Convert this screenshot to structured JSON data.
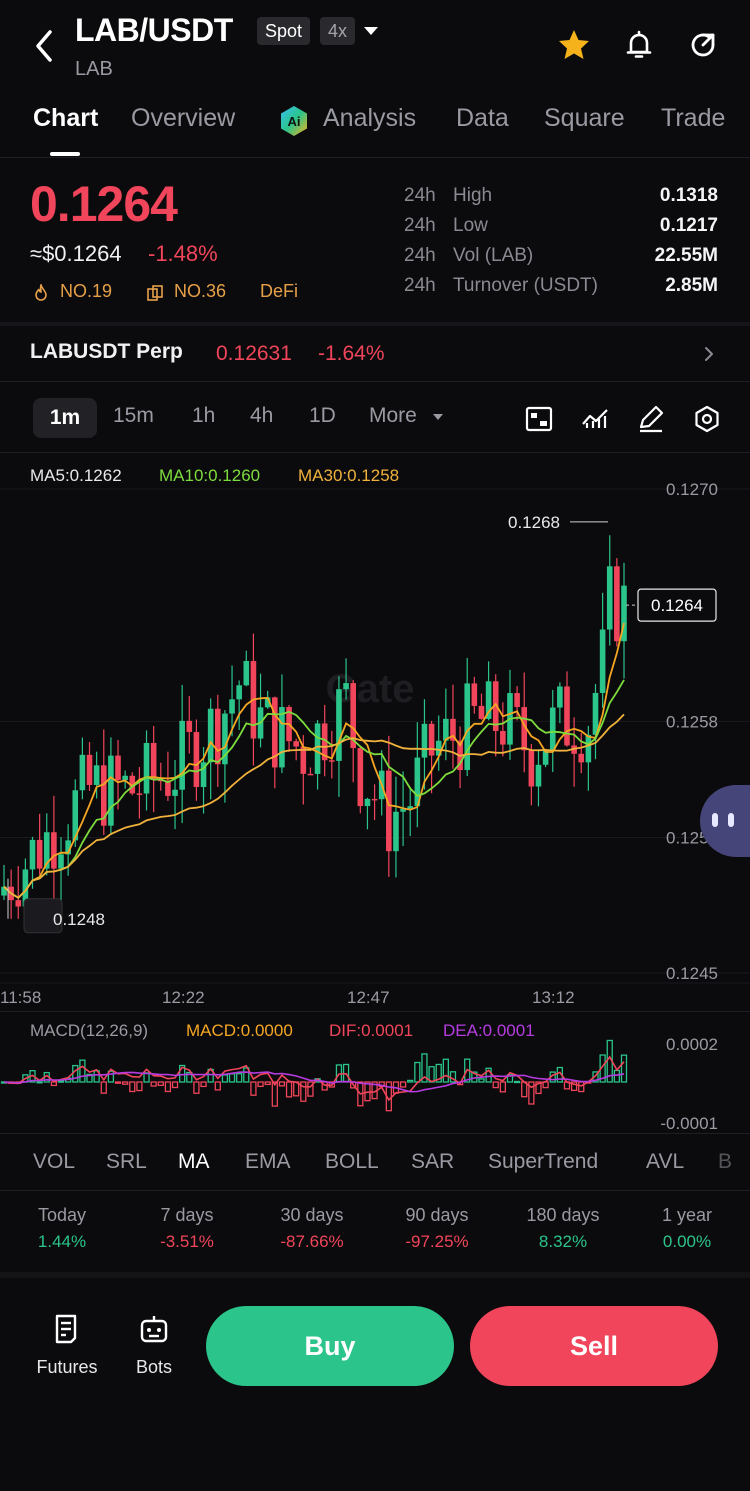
{
  "header": {
    "pair": "LAB/USDT",
    "spot_tag": "Spot",
    "leverage_tag": "4x",
    "subtitle": "LAB"
  },
  "tabs": [
    "Chart",
    "Overview",
    "Analysis",
    "Data",
    "Square",
    "Trade"
  ],
  "price": {
    "last": "0.1264",
    "usd": "≈$0.1264",
    "change": "-1.48%",
    "rank1": "NO.19",
    "rank2": "NO.36",
    "sector": "DeFi"
  },
  "stats": [
    {
      "k1": "24h",
      "k2": "High",
      "v": "0.1318"
    },
    {
      "k1": "24h",
      "k2": "Low",
      "v": "0.1217"
    },
    {
      "k1": "24h",
      "k2": "Vol (LAB)",
      "v": "22.55M"
    },
    {
      "k1": "24h",
      "k2": "Turnover (USDT)",
      "v": "2.85M"
    }
  ],
  "perp": {
    "name": "LABUSDT Perp",
    "price": "0.12631",
    "change": "-1.64%"
  },
  "intervals": [
    "1m",
    "15m",
    "1h",
    "4h",
    "1D",
    "More"
  ],
  "ma_legend": {
    "ma5": "MA5:0.1262",
    "ma10": "MA10:0.1260",
    "ma30": "MA30:0.1258"
  },
  "colors": {
    "ma5": "#f5a623",
    "ma10": "#7ddc3d",
    "ma30": "#f0b23c",
    "up": "#2bc48a",
    "down": "#f0455a",
    "macd": "#f5a623",
    "dif": "#f0455a",
    "dea": "#b63ce0"
  },
  "chart_data": {
    "type": "candlestick",
    "y_ticks": [
      "0.1270",
      "0.1258",
      "0.1252",
      "0.1245"
    ],
    "x_ticks": [
      "11:58",
      "12:22",
      "12:47",
      "13:12"
    ],
    "ylim": [
      0.1245,
      0.127
    ],
    "high_label": "0.1268",
    "low_label": "0.1248",
    "last_label": "0.1264",
    "watermark": "Gate"
  },
  "macd": {
    "label": "MACD(12,26,9)",
    "macd": "MACD:0.0000",
    "dif": "DIF:0.0001",
    "dea": "DEA:0.0001",
    "y_top": "0.0002",
    "y_bottom": "-0.0001"
  },
  "indicators": [
    "VOL",
    "SRL",
    "MA",
    "EMA",
    "BOLL",
    "SAR",
    "SuperTrend",
    "AVL",
    "B"
  ],
  "periods": [
    {
      "label": "Today",
      "value": "1.44%"
    },
    {
      "label": "7 days",
      "value": "-3.51%"
    },
    {
      "label": "30 days",
      "value": "-87.66%"
    },
    {
      "label": "90 days",
      "value": "-97.25%"
    },
    {
      "label": "180 days",
      "value": "8.32%"
    },
    {
      "label": "1 year",
      "value": "0.00%"
    }
  ],
  "bottom": {
    "futures": "Futures",
    "bots": "Bots",
    "buy": "Buy",
    "sell": "Sell"
  }
}
